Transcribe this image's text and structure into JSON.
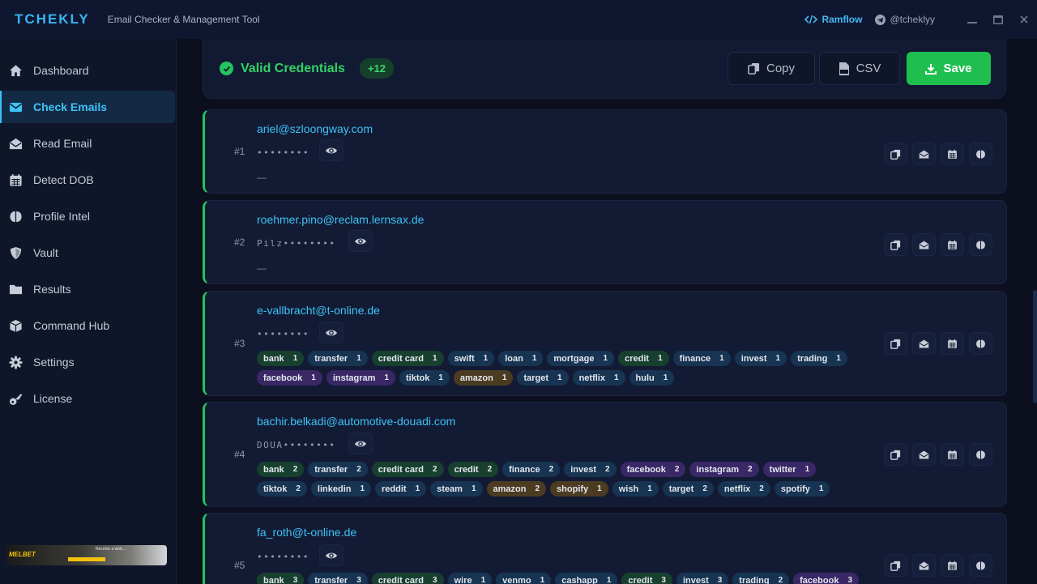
{
  "app": {
    "title": "TCHEKLY",
    "tagline": "Email Checker & Management Tool",
    "ramflow": "Ramflow",
    "handle": "@tcheklyy",
    "window_controls": [
      "minimize-icon",
      "maximize-icon",
      "close-icon"
    ]
  },
  "sidebar": {
    "items": [
      {
        "label": "Dashboard",
        "icon": "home-icon"
      },
      {
        "label": "Check Emails",
        "icon": "envelope-icon",
        "active": true
      },
      {
        "label": "Read Email",
        "icon": "envelope-open-icon"
      },
      {
        "label": "Detect DOB",
        "icon": "calendar-icon"
      },
      {
        "label": "Profile Intel",
        "icon": "brain-icon"
      },
      {
        "label": "Vault",
        "icon": "shield-icon"
      },
      {
        "label": "Results",
        "icon": "folder-icon"
      },
      {
        "label": "Command Hub",
        "icon": "cube-icon"
      },
      {
        "label": "Settings",
        "icon": "gear-icon"
      },
      {
        "label": "License",
        "icon": "key-icon"
      }
    ],
    "banner": {
      "brand": "MELBET",
      "text": "Receive a welc..."
    }
  },
  "header": {
    "title": "Valid Credentials",
    "count": "+12",
    "copy_label": "Copy",
    "csv_label": "CSV",
    "save_label": "Save"
  },
  "colors": {
    "accent": "#3ec2f5",
    "success": "#22c55e",
    "save": "#1fbf4f"
  },
  "results": [
    {
      "num": "#1",
      "email": "ariel@szloongway.com",
      "password": "••••••••",
      "note": "—",
      "tags": []
    },
    {
      "num": "#2",
      "email": "roehmer.pino@reclam.lernsax.de",
      "password": "Pilz••••••••",
      "note": "—",
      "tags": []
    },
    {
      "num": "#3",
      "email": "e-vallbracht@t-online.de",
      "password": "••••••••",
      "note": "",
      "tags": [
        [
          {
            "l": "bank",
            "n": "1",
            "c": "green"
          },
          {
            "l": "transfer",
            "n": "1",
            "c": "blue"
          },
          {
            "l": "credit card",
            "n": "1",
            "c": "green"
          },
          {
            "l": "swift",
            "n": "1",
            "c": "blue"
          },
          {
            "l": "loan",
            "n": "1",
            "c": "blue"
          },
          {
            "l": "mortgage",
            "n": "1",
            "c": "blue"
          },
          {
            "l": "credit",
            "n": "1",
            "c": "green"
          },
          {
            "l": "finance",
            "n": "1",
            "c": "blue"
          },
          {
            "l": "invest",
            "n": "1",
            "c": "blue"
          },
          {
            "l": "trading",
            "n": "1",
            "c": "blue"
          }
        ],
        [
          {
            "l": "facebook",
            "n": "1",
            "c": "purple"
          },
          {
            "l": "instagram",
            "n": "1",
            "c": "purple"
          },
          {
            "l": "tiktok",
            "n": "1",
            "c": "blue"
          },
          {
            "l": "amazon",
            "n": "1",
            "c": "brown"
          },
          {
            "l": "target",
            "n": "1",
            "c": "blue"
          },
          {
            "l": "netflix",
            "n": "1",
            "c": "blue"
          },
          {
            "l": "hulu",
            "n": "1",
            "c": "blue"
          }
        ]
      ]
    },
    {
      "num": "#4",
      "email": "bachir.belkadi@automotive-douadi.com",
      "password": "DOUA••••••••",
      "note": "",
      "tags": [
        [
          {
            "l": "bank",
            "n": "2",
            "c": "green"
          },
          {
            "l": "transfer",
            "n": "2",
            "c": "blue"
          },
          {
            "l": "credit card",
            "n": "2",
            "c": "green"
          },
          {
            "l": "credit",
            "n": "2",
            "c": "green"
          },
          {
            "l": "finance",
            "n": "2",
            "c": "blue"
          },
          {
            "l": "invest",
            "n": "2",
            "c": "blue"
          },
          {
            "l": "facebook",
            "n": "2",
            "c": "purple"
          },
          {
            "l": "instagram",
            "n": "2",
            "c": "purple"
          },
          {
            "l": "twitter",
            "n": "1",
            "c": "purple"
          }
        ],
        [
          {
            "l": "tiktok",
            "n": "2",
            "c": "blue"
          },
          {
            "l": "linkedin",
            "n": "1",
            "c": "blue"
          },
          {
            "l": "reddit",
            "n": "1",
            "c": "blue"
          },
          {
            "l": "steam",
            "n": "1",
            "c": "blue"
          },
          {
            "l": "amazon",
            "n": "2",
            "c": "brown"
          },
          {
            "l": "shopify",
            "n": "1",
            "c": "brown"
          },
          {
            "l": "wish",
            "n": "1",
            "c": "blue"
          },
          {
            "l": "target",
            "n": "2",
            "c": "blue"
          },
          {
            "l": "netflix",
            "n": "2",
            "c": "blue"
          },
          {
            "l": "spotify",
            "n": "1",
            "c": "blue"
          }
        ]
      ]
    },
    {
      "num": "#5",
      "email": "fa_roth@t-online.de",
      "password": "••••••••",
      "note": "",
      "tags": [
        [
          {
            "l": "bank",
            "n": "3",
            "c": "green"
          },
          {
            "l": "transfer",
            "n": "3",
            "c": "blue"
          },
          {
            "l": "credit card",
            "n": "3",
            "c": "green"
          },
          {
            "l": "wire",
            "n": "1",
            "c": "blue"
          },
          {
            "l": "venmo",
            "n": "1",
            "c": "blue"
          },
          {
            "l": "cashapp",
            "n": "1",
            "c": "blue"
          },
          {
            "l": "credit",
            "n": "3",
            "c": "green"
          },
          {
            "l": "invest",
            "n": "3",
            "c": "blue"
          },
          {
            "l": "trading",
            "n": "2",
            "c": "blue"
          },
          {
            "l": "facebook",
            "n": "3",
            "c": "purple"
          }
        ]
      ]
    }
  ],
  "row_actions": [
    "copy-icon",
    "envelope-open-icon",
    "calendar-icon",
    "brain-icon"
  ]
}
